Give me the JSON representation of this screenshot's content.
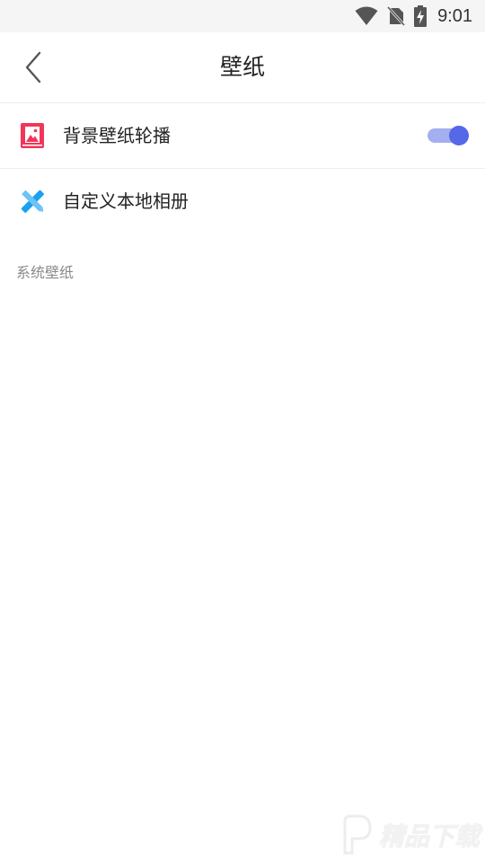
{
  "status_bar": {
    "time": "9:01",
    "icons": [
      "wifi-icon",
      "no-sim-icon",
      "battery-charging-icon"
    ]
  },
  "header": {
    "title": "壁纸",
    "back_icon": "chevron-left-icon"
  },
  "settings": [
    {
      "label": "背景壁纸轮播",
      "icon": "image-gallery-icon",
      "icon_color": "#f0365a",
      "toggle_on": true
    },
    {
      "label": "自定义本地相册",
      "icon": "pencil-ruler-icon",
      "icon_color": "#1aa0f0"
    }
  ],
  "section": {
    "title": "系统壁纸"
  },
  "watermark": {
    "text": "精品下载"
  },
  "colors": {
    "toggle_track": "#a3afee",
    "toggle_knob": "#5468e8",
    "status_bar_bg": "#f5f5f5",
    "section_text": "#8a8a8a"
  }
}
